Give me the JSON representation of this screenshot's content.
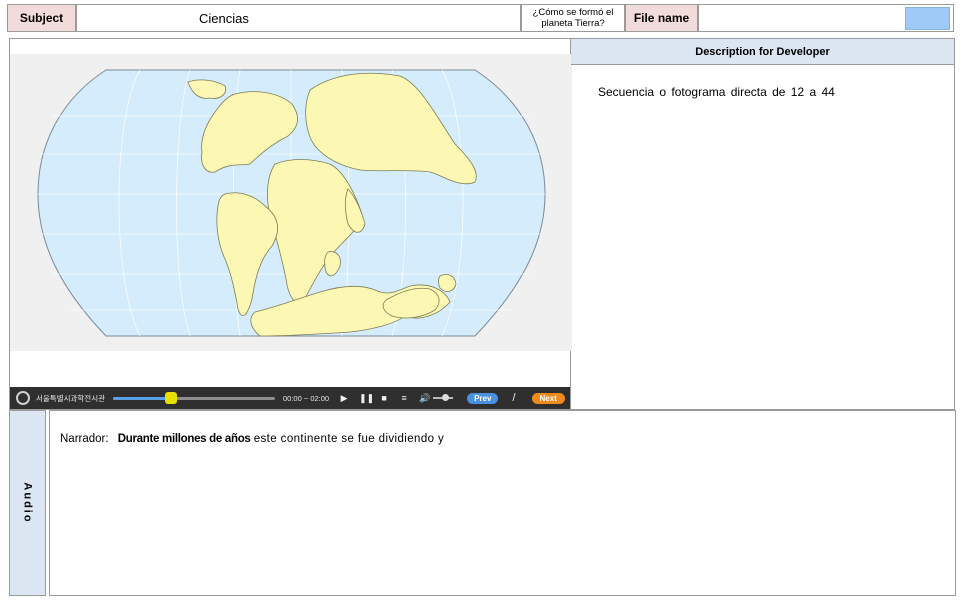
{
  "header": {
    "subject_label": "Subject",
    "subject_value": "Ciencias",
    "lesson_title": "¿Cómo se formó el planeta Tierra?",
    "file_label": "File name",
    "file_value": ""
  },
  "player": {
    "museum_name": "서울특별시과학전시관",
    "time": "00:00 ~ 02:00",
    "progress": 0.36,
    "prev_label": "Prev",
    "separator": "/",
    "next_label": "Next"
  },
  "description": {
    "title": "Description for Developer",
    "text": "Secuencia o fotograma directa de 12 a 44"
  },
  "audio": {
    "label": "Audio",
    "speaker": "Narrador:",
    "bold_text": "Durante millones de años",
    "rest_text": "este continente se fue dividiendo y"
  },
  "colors": {
    "ocean": "#d4ecfb",
    "land": "#fcf7b3",
    "subject_bg": "#f2dcdb",
    "panel_header_bg": "#dce6f2"
  }
}
